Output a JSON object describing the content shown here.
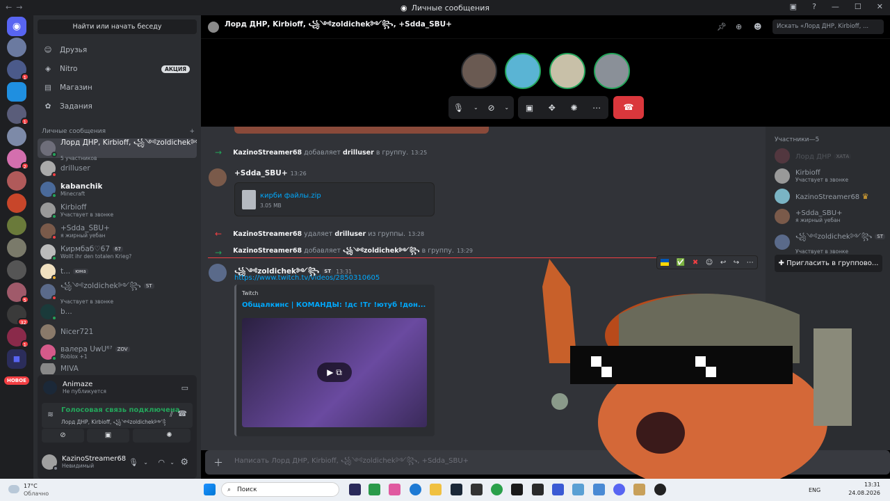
{
  "window": {
    "title": "Личные сообщения"
  },
  "guilds": {
    "new_badge": "НОВОЕ",
    "badges": [
      "1",
      "1",
      "2",
      "32",
      "5",
      "1"
    ]
  },
  "sidebar": {
    "search_label": "Найти или начать беседу",
    "nav": [
      {
        "label": "Друзья",
        "icon": "friends-icon"
      },
      {
        "label": "Nitro",
        "icon": "nitro-icon",
        "pill": "АКЦИЯ"
      },
      {
        "label": "Магазин",
        "icon": "shop-icon"
      },
      {
        "label": "Задания",
        "icon": "quests-icon"
      }
    ],
    "section_title": "Личные сообщения",
    "dms": [
      {
        "name": "Лорд ДНР, Kirbioff, ꧁༺zoldichek༻꧂...",
        "sub": "5 участников",
        "active": true
      },
      {
        "name": "drilluser",
        "sub": ""
      },
      {
        "name": "kabanchik",
        "sub": "Minecraft"
      },
      {
        "name": "Kirbioff",
        "sub": "Участвует в звонке"
      },
      {
        "name": "+Sdda_SBU+",
        "sub": "я жирный уебан"
      },
      {
        "name": "Кирмбаб♡67",
        "tag": "67",
        "sub": "Wollt ihr den totalen Krieg?"
      },
      {
        "name": "t...",
        "tag": "юма",
        "sub": ""
      },
      {
        "name": "꧁༺zoldichek༻꧂",
        "tag": "ST",
        "sub": "Участвует в звонке"
      },
      {
        "name": "b...",
        "sub": ""
      },
      {
        "name": "Nicer721",
        "sub": ""
      },
      {
        "name": "валера UwU⁶⁷",
        "tag": "ZOV",
        "sub": "Roblox +1"
      },
      {
        "name": "MIVA",
        "sub": ""
      }
    ],
    "activity": {
      "name": "Animaze",
      "status": "Не публикуется"
    },
    "voice": {
      "status": "Голосовая связь подключена",
      "channel": "Лорд ДНР, Kirbioff, ꧁༺zoldichek༻꧂, +Sdda_..."
    },
    "user": {
      "name": "KazinoStreamer68",
      "status": "Невидимый"
    }
  },
  "chat": {
    "title": "Лорд ДНР, Kirbioff, ꧁༺zoldichek༻꧂, +Sdda_SBU+",
    "search_placeholder": "Искать «Лорд ДНР, Kirbioff, ...",
    "composer_placeholder": "Написать Лорд ДНР, Kirbioff, ꧁༺zoldichek༻꧂, +Sdda_SBU+",
    "messages": {
      "sys1": {
        "actor": "KazinoStreamer68",
        "verb": "добавляет",
        "target": "drilluser",
        "tail": "в группу.",
        "time": "13:25"
      },
      "msg1": {
        "author": "+Sdda_SBU+",
        "time": "13:26",
        "file_name": "кирби файлы.zip",
        "file_size": "3.05 MB"
      },
      "sys2": {
        "actor": "KazinoStreamer68",
        "verb": "удаляет",
        "target": "drilluser",
        "tail": "из группы.",
        "time": "13:28"
      },
      "sys3": {
        "actor": "KazinoStreamer68",
        "verb": "добавляет",
        "target": "꧁༺zoldichek༻꧂",
        "tail": "в группу.",
        "time": "13:29"
      },
      "msg2": {
        "author": "꧁༺zoldichek༻꧂",
        "tag": "ST",
        "time": "13:31",
        "link": "https://www.twitch.tv/videos/2850310605",
        "embed_provider": "Twitch",
        "embed_title": "Общалкинс | КОМАНДЫ: !дс !Тг !ютуб !дон..."
      }
    },
    "members": {
      "header": "Участники—5",
      "list": [
        {
          "name": "Лорд ДНР",
          "tag": "ХАТА",
          "sub": ""
        },
        {
          "name": "Kirbioff",
          "sub": "Участвует в звонке"
        },
        {
          "name": "KazinoStreamer68",
          "sub": ""
        },
        {
          "name": "+Sdda_SBU+",
          "sub": "я жирный уебан"
        },
        {
          "name": "꧁༺zoldichek༻꧂",
          "tag": "ST",
          "sub": "Участвует в звонке"
        }
      ],
      "invite_label": "Пригласить в группово..."
    }
  },
  "taskbar": {
    "weather_temp": "17°C",
    "weather_desc": "Облачно",
    "search": "Поиск",
    "lang": "ENG",
    "time": "13:31",
    "date": "24.08.2026"
  },
  "colors": {
    "accent": "#5865f2",
    "online": "#23a55a",
    "danger": "#da373c"
  }
}
